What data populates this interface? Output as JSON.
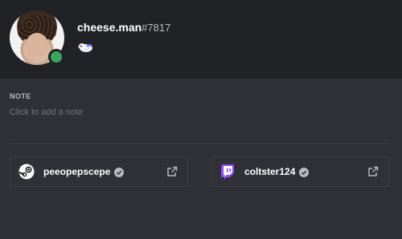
{
  "profile": {
    "username": "cheese.man",
    "discriminator": "#7817",
    "status": "online",
    "status_color": "#3ba55d",
    "badge_icon": "bird-badge-icon"
  },
  "note": {
    "label": "NOTE",
    "placeholder": "Click to add a note"
  },
  "connected_accounts": [
    {
      "platform": "steam",
      "name": "peeopepscepe",
      "verified": true,
      "icon": "steam-icon"
    },
    {
      "platform": "twitch",
      "name": "coltster124",
      "verified": true,
      "icon": "twitch-icon"
    }
  ],
  "colors": {
    "header_bg": "#202225",
    "body_bg": "#2f3136",
    "twitch_purple": "#9146ff"
  }
}
